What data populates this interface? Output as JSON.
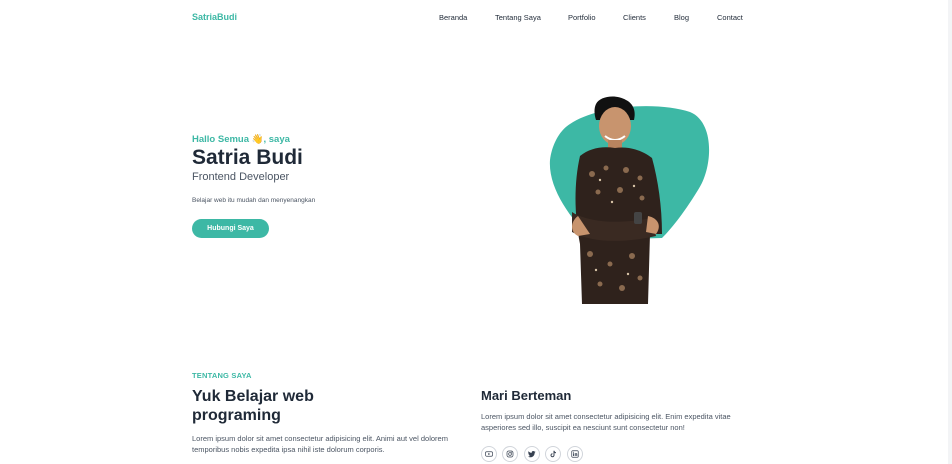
{
  "brand": {
    "name": "SatriaBudi"
  },
  "nav": {
    "items": [
      {
        "label": "Beranda"
      },
      {
        "label": "Tentang Saya"
      },
      {
        "label": "Portfolio"
      },
      {
        "label": "Clients"
      },
      {
        "label": "Blog"
      },
      {
        "label": "Contact"
      }
    ]
  },
  "hero": {
    "greeting": "Hallo Semua 👋, saya",
    "name": "Satria Budi",
    "role": "Frontend Developer",
    "tagline": "Belajar web itu mudah dan menyenangkan",
    "cta_label": "Hubungi Saya",
    "accent_color": "#3db8a5"
  },
  "about": {
    "eyebrow": "TENTANG SAYA",
    "title": "Yuk Belajar web programing",
    "body": "Lorem ipsum dolor sit amet consectetur adipisicing elit. Animi aut vel dolorem temporibus nobis expedita ipsa nihil iste dolorum corporis."
  },
  "connect": {
    "title": "Mari Berteman",
    "body": "Lorem ipsum dolor sit amet consectetur adipisicing elit. Enim expedita vitae asperiores sed illo, suscipit ea nesciunt sunt consectetur non!",
    "socials": [
      {
        "icon": "youtube-icon"
      },
      {
        "icon": "instagram-icon"
      },
      {
        "icon": "twitter-icon"
      },
      {
        "icon": "tiktok-icon"
      },
      {
        "icon": "linkedin-icon"
      }
    ]
  }
}
